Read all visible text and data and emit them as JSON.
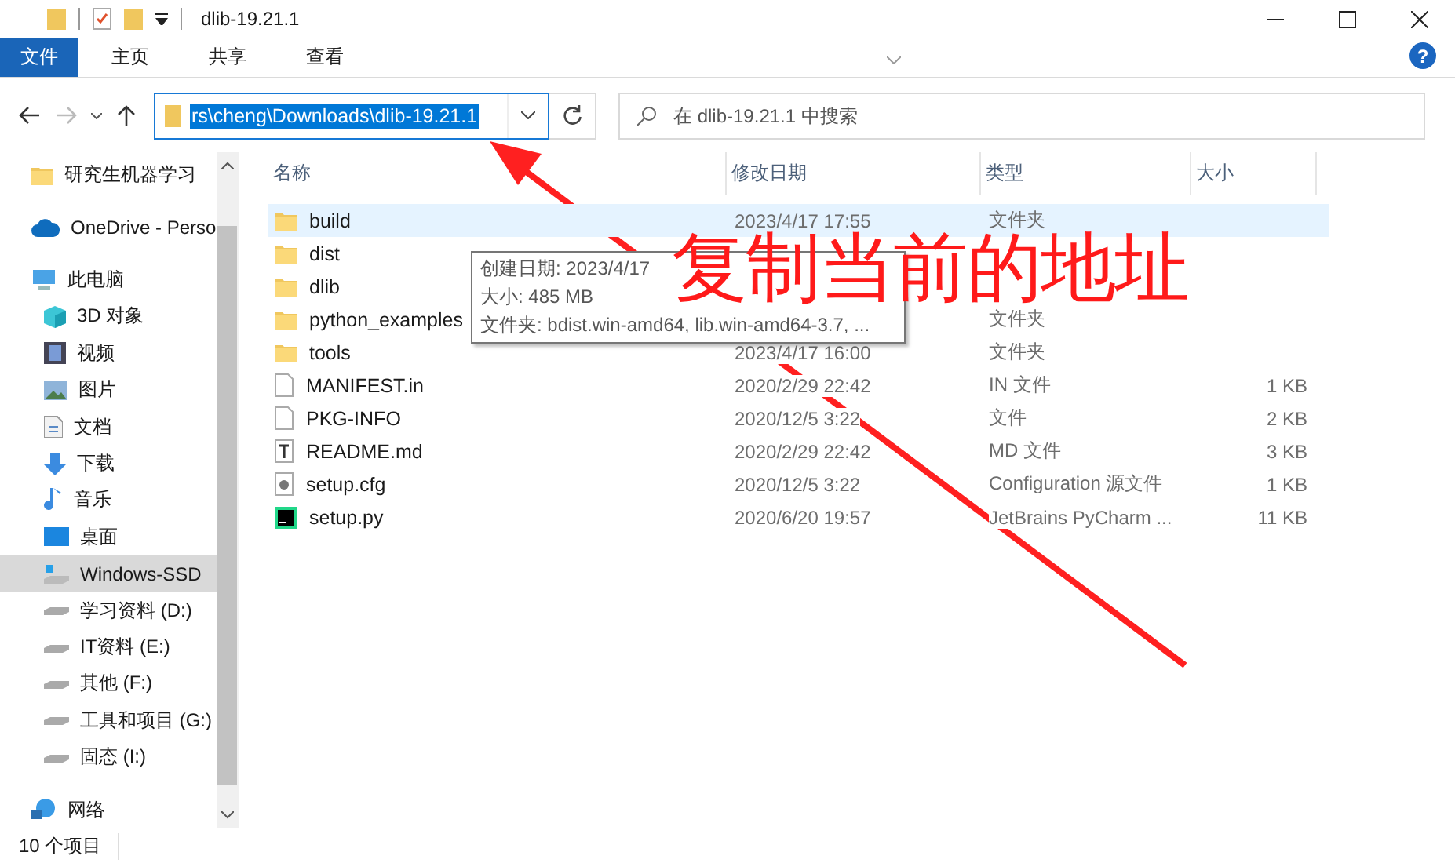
{
  "window": {
    "title": "dlib-19.21.1"
  },
  "ribbon": {
    "tabs": [
      {
        "label": "文件",
        "selected": true
      },
      {
        "label": "主页",
        "selected": false
      },
      {
        "label": "共享",
        "selected": false
      },
      {
        "label": "查看",
        "selected": false
      }
    ],
    "help": "?"
  },
  "address": {
    "value": "rs\\cheng\\Downloads\\dlib-19.21.1",
    "selected": true
  },
  "search": {
    "placeholder": "在 dlib-19.21.1 中搜索"
  },
  "sidebar": {
    "items": [
      {
        "label": "研究生机器学习",
        "kind": "folder",
        "selected": false
      },
      {
        "label": "OneDrive - Perso",
        "kind": "cloud",
        "selected": false
      },
      {
        "label": "此电脑",
        "kind": "pc",
        "selected": false,
        "children": [
          {
            "label": "3D 对象",
            "kind": "cube",
            "selected": false
          },
          {
            "label": "视频",
            "kind": "video",
            "selected": false
          },
          {
            "label": "图片",
            "kind": "picture",
            "selected": false
          },
          {
            "label": "文档",
            "kind": "doc",
            "selected": false
          },
          {
            "label": "下载",
            "kind": "download",
            "selected": false
          },
          {
            "label": "音乐",
            "kind": "music",
            "selected": false
          },
          {
            "label": "桌面",
            "kind": "desktop",
            "selected": false
          },
          {
            "label": "Windows-SSD",
            "kind": "winDrive",
            "selected": true
          },
          {
            "label": "学习资料 (D:)",
            "kind": "drive",
            "selected": false
          },
          {
            "label": "IT资料 (E:)",
            "kind": "drive",
            "selected": false
          },
          {
            "label": "其他 (F:)",
            "kind": "drive",
            "selected": false
          },
          {
            "label": "工具和项目 (G:)",
            "kind": "drive",
            "selected": false
          },
          {
            "label": "固态 (I:)",
            "kind": "drive",
            "selected": false
          }
        ]
      },
      {
        "label": "网络",
        "kind": "network",
        "selected": false
      }
    ]
  },
  "table": {
    "columns": [
      "名称",
      "修改日期",
      "类型",
      "大小"
    ],
    "rows": [
      {
        "name": "build",
        "kind": "folder",
        "date": "2023/4/17 17:55",
        "type": "文件夹",
        "hovered": true
      },
      {
        "name": "dist",
        "kind": "folder"
      },
      {
        "name": "dlib",
        "kind": "folder"
      },
      {
        "name": "python_examples",
        "kind": "folder",
        "type": "文件夹"
      },
      {
        "name": "tools",
        "kind": "folder",
        "date": "2023/4/17 16:00",
        "type": "文件夹"
      },
      {
        "name": "MANIFEST.in",
        "kind": "file",
        "date": "2020/2/29 22:42",
        "type": "IN 文件",
        "size": "1 KB"
      },
      {
        "name": "PKG-INFO",
        "kind": "file",
        "date": "2020/12/5 3:22",
        "type": "文件",
        "size": "2 KB"
      },
      {
        "name": "README.md",
        "kind": "text",
        "date": "2020/2/29 22:42",
        "type": "MD 文件",
        "size": "3 KB"
      },
      {
        "name": "setup.cfg",
        "kind": "config",
        "date": "2020/12/5 3:22",
        "type": "Configuration 源文件",
        "size": "1 KB"
      },
      {
        "name": "setup.py",
        "kind": "pycharm",
        "date": "2020/6/20 19:57",
        "type": "JetBrains PyCharm ...",
        "size": "11 KB"
      }
    ]
  },
  "tooltip": {
    "lines": [
      "创建日期: 2023/4/17",
      "大小: 485 MB",
      "文件夹: bdist.win-amd64, lib.win-amd64-3.7, ..."
    ]
  },
  "annotation": {
    "text": "复制当前的地址"
  },
  "status_bar": {
    "count": "10 个项目"
  }
}
